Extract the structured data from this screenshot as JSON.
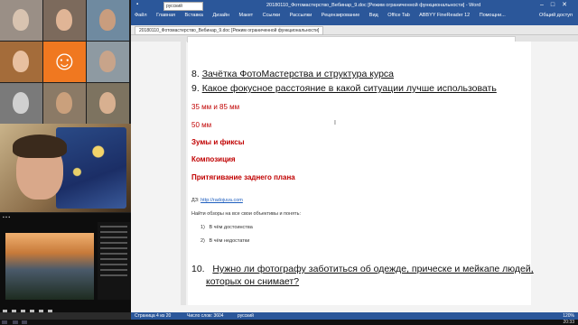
{
  "word": {
    "title": "20180110_Фотомастерство_Вебинар_9.doc [Режим ограниченной функциональности] - Word",
    "language_box": "русский",
    "tabs": [
      "Файл",
      "Главная",
      "Вставка",
      "Дизайн",
      "Макет",
      "Ссылки",
      "Рассылки",
      "Рецензирование",
      "Вид",
      "Office Tab",
      "ABBYY FineReader 12",
      "Помощни..."
    ],
    "share": "Общий доступ",
    "doc_tab": "20180110_Фотомастерство_Вебинар_9.doc [Режим ограниченной функциональности]",
    "content": {
      "h8_num": "8.",
      "h8_text": "Зачётка ФотоМастерства и структура курса",
      "h9_num": "9.",
      "h9_text": "Какое фокусное расстояние в какой ситуации лучше использовать",
      "r1": "35 мм и 85 мм",
      "r2": "50 мм",
      "r3": "Зумы и фиксы",
      "r4": "Композиция",
      "r5": "Притягивание заднего плана",
      "dz_label": "ДЗ:",
      "dz_link": "http://radojuva.com",
      "task": "Найти обзоры на все свои объективы и понять:",
      "li1_num": "1)",
      "li1": "В чём достоинства",
      "li2_num": "2)",
      "li2": "В чём недостатки",
      "h10_num": "10.",
      "h10_line1": "Нужно ли фотографу заботиться об одежде, прическе и мейкапе людей,",
      "h10_line2": "которых он снимает?"
    },
    "status": {
      "page": "Страница 4 из 20",
      "words": "Число слов: 3604",
      "lang": "русский",
      "zoom": "120%"
    }
  },
  "taskbar": {
    "time": "20:33"
  },
  "colors": {
    "ribbon": "#2b579a",
    "accent_red": "#c00000",
    "link": "#1f5fbf"
  }
}
